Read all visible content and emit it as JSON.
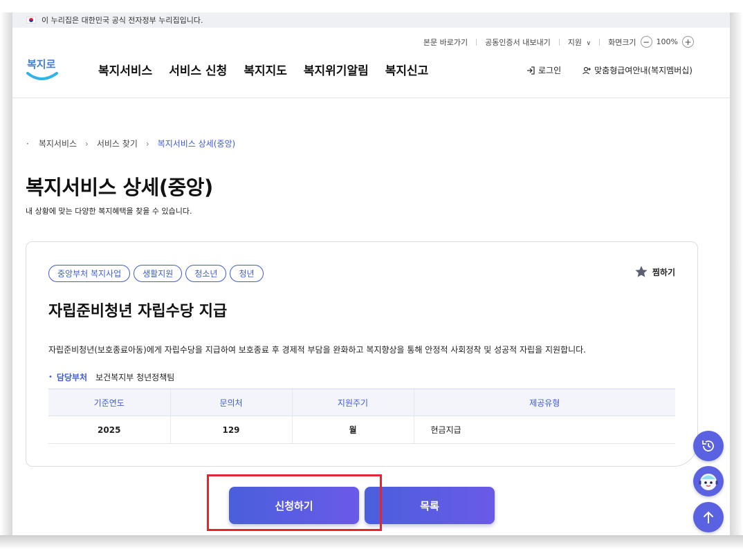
{
  "gov_banner": "이 누리집은 대한민국 공식 전자정부 누리집입니다.",
  "utility": {
    "skip": "본문 바로가기",
    "cert": "공동인증서 내보내기",
    "support": "지원",
    "screen_size": "화면크기",
    "zoom": "100%",
    "minus": "−",
    "plus": "+"
  },
  "logo_text": "복지로",
  "nav": [
    "복지서비스",
    "서비스 신청",
    "복지지도",
    "복지위기알림",
    "복지신고"
  ],
  "auth": {
    "login": "로그인",
    "membership": "맞춤형급여안내(복지멤버십)"
  },
  "breadcrumb": {
    "dot": "·",
    "items": [
      "복지서비스",
      "서비스 찾기",
      "복지서비스 상세(중앙)"
    ]
  },
  "page": {
    "title": "복지서비스 상세(중앙)",
    "subtitle": "내 상황에 맞는 다양한 복지혜택을 찾을 수 있습니다."
  },
  "service": {
    "tags": [
      "중앙부처 복지사업",
      "생활지원",
      "청소년",
      "청년"
    ],
    "favorite": "찜하기",
    "title": "자립준비청년 자립수당 지급",
    "description": "자립준비청년(보호종료아동)에게 자립수당을 지급하여 보호종료 후 경제적 부담을 완화하고 복지향상을 통해 안정적 사회정착 및 성공적 자립을 지원합니다.",
    "dept_label": "담당부처",
    "dept_value": "보건복지부 청년정책팀",
    "table": {
      "headers": [
        "기준연도",
        "문의처",
        "지원주기",
        "제공유형"
      ],
      "row": [
        "2025",
        "129",
        "월",
        "현금지급"
      ]
    }
  },
  "buttons": {
    "apply": "신청하기",
    "list": "목록"
  },
  "colors": {
    "accent": "#3f5bd6",
    "button": "#5a62e2",
    "highlight": "#e3262e"
  }
}
